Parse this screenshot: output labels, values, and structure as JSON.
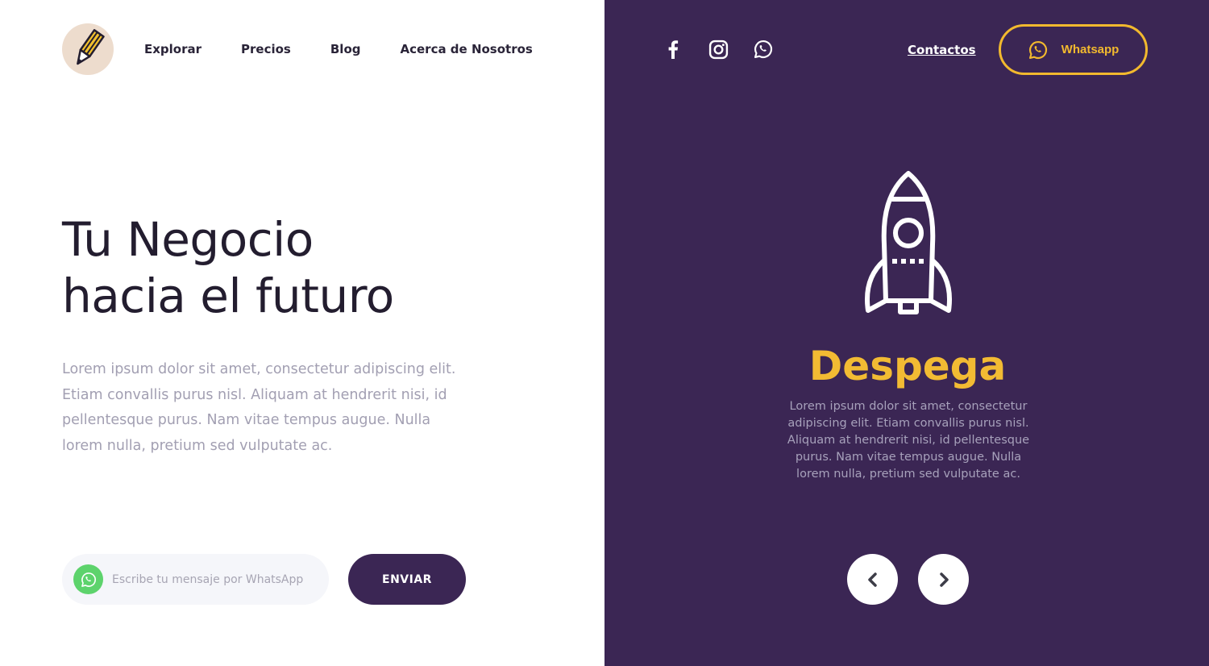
{
  "nav": {
    "items": [
      {
        "label": "Explorar"
      },
      {
        "label": "Precios"
      },
      {
        "label": "Blog"
      },
      {
        "label": "Acerca de Nosotros"
      }
    ]
  },
  "hero": {
    "title_line1": "Tu Negocio",
    "title_line2": "hacia el futuro",
    "text": "Lorem ipsum dolor sit amet, consectetur adipiscing elit. Etiam convallis purus nisl. Aliquam at hendrerit nisi, id pellentesque purus. Nam vitae tempus augue. Nulla lorem nulla, pretium sed vulputate ac."
  },
  "message_form": {
    "placeholder": "Escribe tu mensaje por WhatsApp",
    "value": "",
    "send_label": "ENVIAR"
  },
  "header_right": {
    "contact_label": "Contactos",
    "whatsapp_label": "Whatsapp",
    "social_icons": [
      "facebook-icon",
      "instagram-icon",
      "whatsapp-icon"
    ]
  },
  "feature": {
    "icon": "rocket-icon",
    "title": "Despega",
    "text": "Lorem ipsum dolor sit amet, consectetur adipiscing elit. Etiam convallis purus nisl. Aliquam at hendrerit nisi, id pellentesque purus. Nam vitae tempus augue. Nulla lorem nulla, pretium sed vulputate ac."
  },
  "colors": {
    "brand_purple": "#3b2654",
    "accent_yellow": "#f2b92e",
    "whatsapp_green": "#5dd36c",
    "logo_bg": "#eddccd"
  }
}
